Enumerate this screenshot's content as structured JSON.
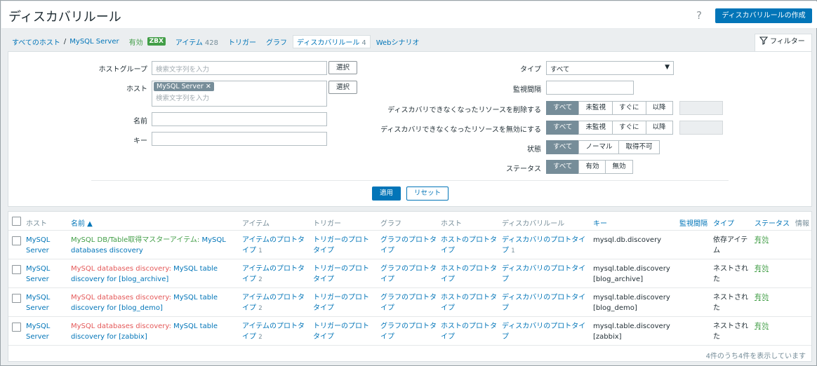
{
  "page": {
    "title": "ディスカバリルール",
    "help_icon": "?",
    "create_label": "ディスカバリルールの作成"
  },
  "nav": {
    "all_hosts": "すべてのホスト",
    "separator": "/",
    "host": "MySQL Server",
    "enabled": "有効",
    "zbx": "ZBX",
    "items": "アイテム",
    "items_count": "428",
    "triggers": "トリガー",
    "graphs": "グラフ",
    "discovery": "ディスカバリルール",
    "discovery_count": "4",
    "web": "Webシナリオ"
  },
  "filter": {
    "tab_label": "フィルター",
    "hostgroup_label": "ホストグループ",
    "hostgroup_placeholder": "検索文字列を入力",
    "select_label": "選択",
    "host_label": "ホスト",
    "host_tag": "MySQL Server",
    "host_placeholder": "検索文字列を入力",
    "name_label": "名前",
    "key_label": "キー",
    "type_label": "タイプ",
    "type_value": "すべて",
    "interval_label": "監視間隔",
    "delete_lost_label": "ディスカバリできなくなったリソースを削除する",
    "disable_lost_label": "ディスカバリできなくなったリソースを無効にする",
    "lost_options": [
      "すべて",
      "未監視",
      "すぐに",
      "以降"
    ],
    "state_label": "状態",
    "state_options": [
      "すべて",
      "ノーマル",
      "取得不可"
    ],
    "status_label": "ステータス",
    "status_options": [
      "すべて",
      "有効",
      "無効"
    ],
    "apply": "適用",
    "reset": "リセット"
  },
  "table": {
    "headers": {
      "host": "ホスト",
      "name": "名前 ▲",
      "items": "アイテム",
      "triggers": "トリガー",
      "graphs": "グラフ",
      "hosts": "ホスト",
      "discovery": "ディスカバリルール",
      "key": "キー",
      "interval": "監視間隔",
      "type": "タイプ",
      "status": "ステータス",
      "info": "情報"
    },
    "rows": [
      {
        "host": "MySQL Server",
        "name_prefix": "MySQL DB/Table取得マスターアイテム: ",
        "name": "MySQL databases discovery",
        "items": "アイテムのプロトタイプ",
        "items_count": "1",
        "triggers": "トリガーのプロトタイプ",
        "graphs": "グラフのプロトタイプ",
        "hosts": "ホストのプロトタイプ",
        "discovery": "ディスカバリのプロトタイプ",
        "discovery_count": "1",
        "key": "mysql.db.discovery",
        "type": "依存アイテム",
        "status": "有効"
      },
      {
        "host": "MySQL Server",
        "name_prefix": "MySQL databases discovery: ",
        "name": "MySQL table discovery for [blog_archive]",
        "items": "アイテムのプロトタイプ",
        "items_count": "2",
        "triggers": "トリガーのプロトタイプ",
        "graphs": "グラフのプロトタイプ",
        "hosts": "ホストのプロトタイプ",
        "discovery": "ディスカバリのプロトタイプ",
        "discovery_count": "",
        "key": "mysql.table.discovery[blog_archive]",
        "type": "ネストされた",
        "status": "有効"
      },
      {
        "host": "MySQL Server",
        "name_prefix": "MySQL databases discovery: ",
        "name": "MySQL table discovery for [blog_demo]",
        "items": "アイテムのプロトタイプ",
        "items_count": "2",
        "triggers": "トリガーのプロトタイプ",
        "graphs": "グラフのプロトタイプ",
        "hosts": "ホストのプロトタイプ",
        "discovery": "ディスカバリのプロトタイプ",
        "discovery_count": "",
        "key": "mysql.table.discovery[blog_demo]",
        "type": "ネストされた",
        "status": "有効"
      },
      {
        "host": "MySQL Server",
        "name_prefix": "MySQL databases discovery: ",
        "name": "MySQL table discovery for [zabbix]",
        "items": "アイテムのプロトタイプ",
        "items_count": "2",
        "triggers": "トリガーのプロトタイプ",
        "graphs": "グラフのプロトタイプ",
        "hosts": "ホストのプロトタイプ",
        "discovery": "ディスカバリのプロトタイプ",
        "discovery_count": "",
        "key": "mysql.table.discovery[zabbix]",
        "type": "ネストされた",
        "status": "有効"
      }
    ],
    "footer": "4件のうち4件を表示しています"
  }
}
